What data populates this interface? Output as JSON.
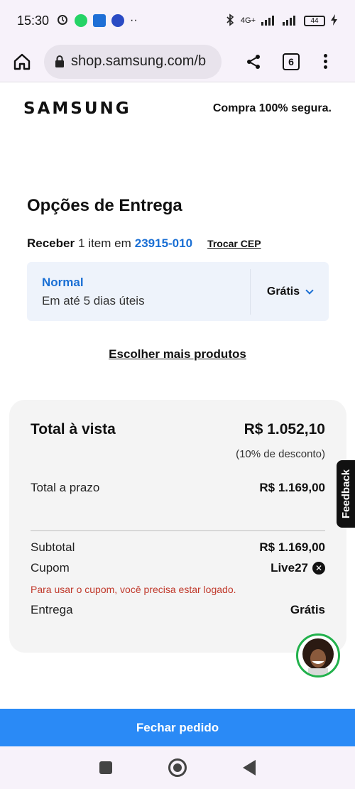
{
  "status_bar": {
    "time": "15:30",
    "network": "4G+",
    "battery": "44"
  },
  "browser": {
    "url": "shop.samsung.com/b",
    "tab_count": "6"
  },
  "header": {
    "logo": "SAMSUNG",
    "secure_text": "Compra 100% segura."
  },
  "delivery": {
    "title": "Opções de Entrega",
    "receive_prefix": "Receber",
    "receive_items": "1 item em",
    "cep": "23915-010",
    "change_cep": "Trocar CEP",
    "option_name": "Normal",
    "option_days": "Em até 5 dias úteis",
    "option_price": "Grátis",
    "more_products": "Escolher mais produtos"
  },
  "summary": {
    "total_cash_label": "Total à vista",
    "total_cash_value": "R$ 1.052,10",
    "discount_note": "(10% de desconto)",
    "total_term_label": "Total a prazo",
    "total_term_value": "R$ 1.169,00",
    "subtotal_label": "Subtotal",
    "subtotal_value": "R$ 1.169,00",
    "coupon_label": "Cupom",
    "coupon_value": "Live27",
    "coupon_warning": "Para usar o cupom, você precisa estar logado.",
    "shipping_label": "Entrega",
    "shipping_value": "Grátis"
  },
  "feedback_label": "Feedback",
  "cta_label": "Fechar pedido",
  "colors": {
    "accent": "#2a8af6",
    "link": "#1a6fd4",
    "warning": "#c0392b",
    "chat_ring": "#22b14c"
  }
}
